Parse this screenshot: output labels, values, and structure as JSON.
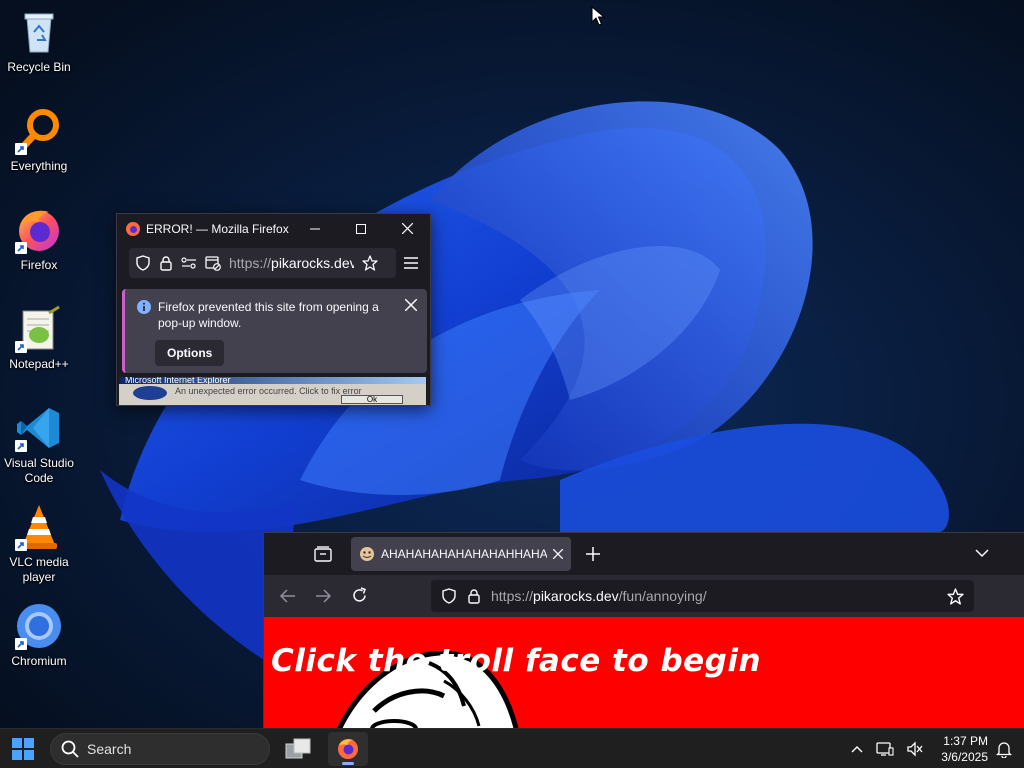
{
  "desktop": {
    "icons": [
      {
        "label": "Recycle Bin",
        "icon": "recycle-bin-icon"
      },
      {
        "label": "Everything",
        "icon": "everything-search-icon"
      },
      {
        "label": "Firefox",
        "icon": "firefox-icon"
      },
      {
        "label": "Notepad++",
        "icon": "notepad-plus-plus-icon"
      },
      {
        "label": "Visual Studio Code",
        "icon": "vscode-icon"
      },
      {
        "label": "VLC media player",
        "icon": "vlc-icon"
      },
      {
        "label": "Chromium",
        "icon": "chromium-icon"
      }
    ]
  },
  "popup": {
    "title": "ERROR! — Mozilla Firefox",
    "url_prefix": "https://",
    "url_host": "pikarocks.dev",
    "notice": "Firefox prevented this site from opening a pop-up window.",
    "options_label": "Options",
    "ie_title": "Microsoft Internet Explorer",
    "ie_message": "An unexpected error occurred. Click to fix error",
    "ie_button": "Ok"
  },
  "browser": {
    "tab_title": "AHAHAHAHAHAHAHAHHAHAHAHA",
    "url_prefix": "https://",
    "url_host": "pikarocks.dev",
    "url_path": "/fun/annoying/",
    "headline": "Click the troll face to begin"
  },
  "taskbar": {
    "search_placeholder": "Search",
    "time": "1:37 PM",
    "date": "3/6/2025"
  },
  "colors": {
    "page_red": "#ff0000",
    "firefox_dark": "#1c1b22",
    "notice_bg": "#42414d",
    "accent_blue": "#2e6bff"
  }
}
